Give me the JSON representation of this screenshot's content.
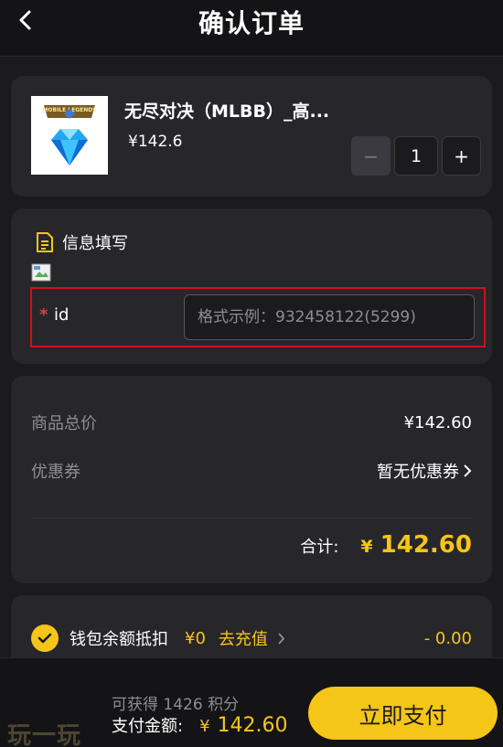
{
  "header": {
    "title": "确认订单",
    "back_icon": "chevron-left-icon"
  },
  "product": {
    "name": "无尽对决（MLBB）_高...",
    "price": "¥142.6",
    "image_logo_text": "MOBILE LEGENDS",
    "quantity": "1",
    "minus_label": "−",
    "plus_label": "+"
  },
  "info": {
    "title": "信息填写",
    "field_required_mark": "*",
    "field_label": "id",
    "field_value": "",
    "field_placeholder": "格式示例：932458122(5299)"
  },
  "summary": {
    "subtotal_label": "商品总价",
    "subtotal_value": "¥142.60",
    "coupon_label": "优惠券",
    "coupon_value": "暂无优惠券",
    "total_label": "合计:",
    "total_currency": "¥",
    "total_amount": "142.60"
  },
  "wallet": {
    "label": "钱包余额抵扣",
    "balance": "¥0",
    "recharge_label": "去充值",
    "deduct_value": "- 0.00",
    "checked": true
  },
  "footer": {
    "watermark": "玩一玩",
    "points_text": "可获得 1426 积分",
    "pay_label": "支付金额:",
    "pay_currency": "¥",
    "pay_amount": "142.60",
    "pay_button": "立即支付"
  },
  "colors": {
    "accent": "#f5c518",
    "background": "#1b1b1e",
    "card": "#27272b",
    "error_border": "#d0101a"
  }
}
